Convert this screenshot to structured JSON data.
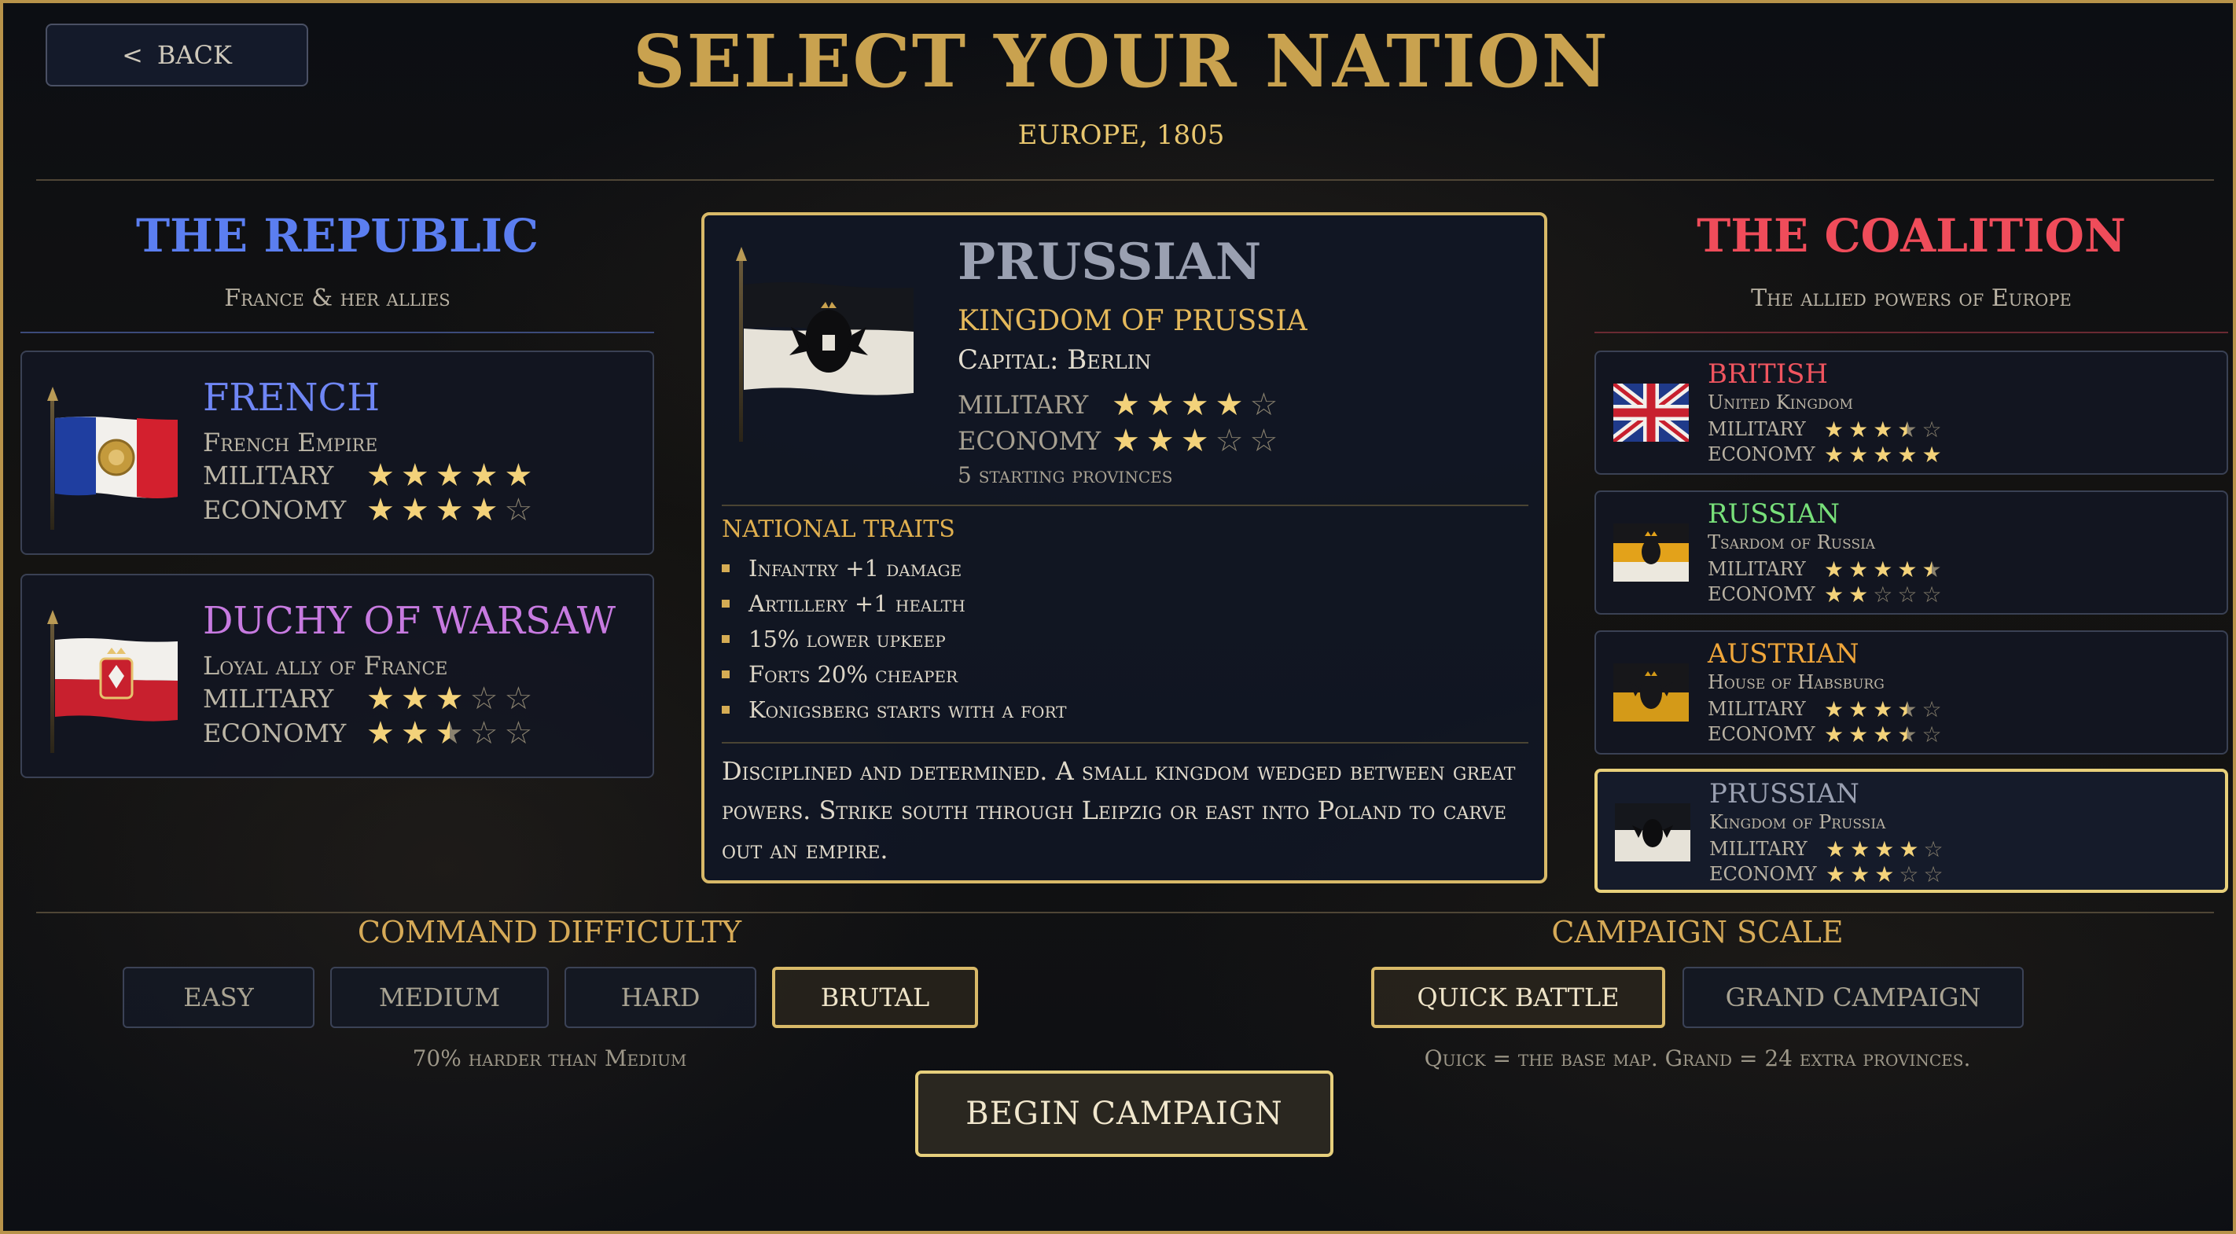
{
  "header": {
    "back_label": "BACK",
    "back_icon": "<",
    "title": "SELECT YOUR NATION",
    "subtitle": "EUROPE, 1805"
  },
  "republic": {
    "title": "THE REPUBLIC",
    "subtitle": "France & her allies",
    "color": "#5b7ef0",
    "nations": [
      {
        "name": "FRENCH",
        "desc": "French Empire",
        "military_label": "MILITARY",
        "economy_label": "ECONOMY",
        "military": 5,
        "economy": 4,
        "name_color": "#6f86f5",
        "flag": "france-flag"
      },
      {
        "name": "DUCHY OF WARSAW",
        "desc": "Loyal ally of France",
        "military_label": "MILITARY",
        "economy_label": "ECONOMY",
        "military": 3,
        "economy": 2.5,
        "name_color": "#c77ae0",
        "flag": "warsaw-flag"
      }
    ]
  },
  "coalition": {
    "title": "THE COALITION",
    "subtitle": "The allied powers of Europe",
    "color": "#ef4c5a",
    "nations": [
      {
        "name": "BRITISH",
        "desc": "United Kingdom",
        "military_label": "MILITARY",
        "economy_label": "ECONOMY",
        "military": 3.5,
        "economy": 5,
        "name_color": "#f0555f",
        "flag": "union-jack-flag"
      },
      {
        "name": "RUSSIAN",
        "desc": "Tsardom of Russia",
        "military_label": "MILITARY",
        "economy_label": "ECONOMY",
        "military": 4.5,
        "economy": 2,
        "name_color": "#78e07a",
        "flag": "russia-flag"
      },
      {
        "name": "AUSTRIAN",
        "desc": "House of Habsburg",
        "military_label": "MILITARY",
        "economy_label": "ECONOMY",
        "military": 3.5,
        "economy": 3.5,
        "name_color": "#f0a63a",
        "flag": "austria-flag"
      },
      {
        "name": "PRUSSIAN",
        "desc": "Kingdom of Prussia",
        "military_label": "MILITARY",
        "economy_label": "ECONOMY",
        "military": 4,
        "economy": 3,
        "name_color": "#9aa0b1",
        "flag": "prussia-flag",
        "selected": true
      }
    ]
  },
  "detail": {
    "name": "PRUSSIAN",
    "kingdom": "KINGDOM OF PRUSSIA",
    "capital": "Capital:  Berlin",
    "military_label": "MILITARY",
    "economy_label": "ECONOMY",
    "military": 4,
    "economy": 3,
    "provinces": "5 starting provinces",
    "traits_title": "NATIONAL TRAITS",
    "traits": [
      "Infantry +1 damage",
      "Artillery +1 health",
      "15% lower upkeep",
      "Forts 20% cheaper",
      "Konigsberg starts with a fort"
    ],
    "blurb": "Disciplined and determined. A small kingdom wedged between great powers. Strike south through Leipzig or east into Poland to carve out an empire."
  },
  "difficulty": {
    "label": "COMMAND DIFFICULTY",
    "options": [
      "EASY",
      "MEDIUM",
      "HARD",
      "BRUTAL"
    ],
    "selected": "BRUTAL",
    "note": "70% harder than Medium"
  },
  "scale": {
    "label": "CAMPAIGN SCALE",
    "options": [
      "QUICK BATTLE",
      "GRAND CAMPAIGN"
    ],
    "selected": "QUICK BATTLE",
    "note": "Quick = the base map.  Grand = 24 extra provinces."
  },
  "begin_label": "BEGIN  CAMPAIGN",
  "colors": {
    "gold": "#c9a24f",
    "panel_border": "#d8b968"
  }
}
